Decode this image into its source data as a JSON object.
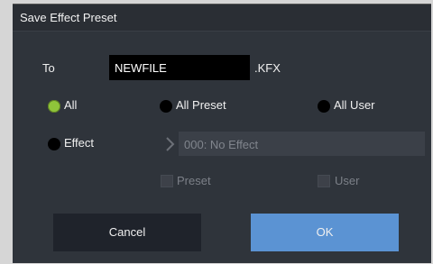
{
  "dialog": {
    "title": "Save Effect Preset",
    "to_label": "To",
    "filename": "NEWFILE",
    "extension": ".KFX",
    "radios": {
      "all": {
        "label": "All",
        "selected": true
      },
      "all_preset": {
        "label": "All Preset",
        "selected": false
      },
      "all_user": {
        "label": "All User",
        "selected": false
      },
      "effect": {
        "label": "Effect",
        "selected": false
      }
    },
    "effect_value": "000: No Effect",
    "checkboxes": {
      "preset": "Preset",
      "user": "User"
    },
    "buttons": {
      "cancel": "Cancel",
      "ok": "OK"
    },
    "colors": {
      "selected_radio": "#8fc43a",
      "ok_button": "#5b93d3"
    }
  }
}
